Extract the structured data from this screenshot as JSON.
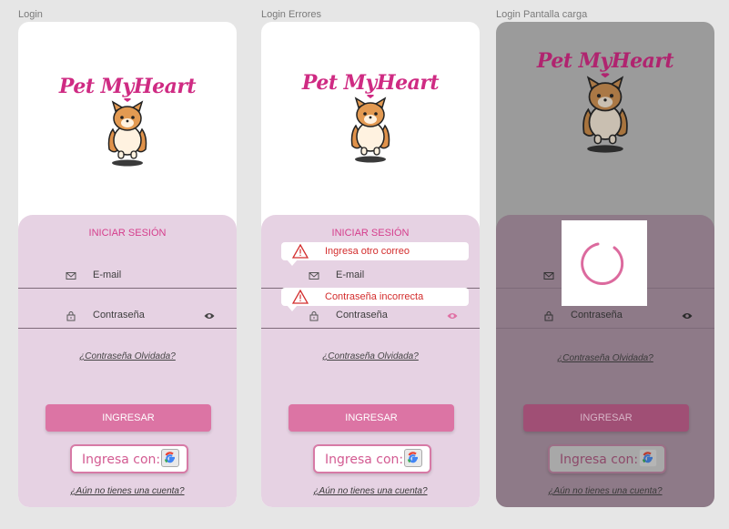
{
  "frames": [
    {
      "label": "Login",
      "logo": "Pet MyHeart",
      "title": "INICIAR SESIÓN",
      "email_placeholder": "E-mail",
      "password_placeholder": "Contraseña",
      "forgot": "¿Contraseña Olvidada?",
      "login_button": "INGRESAR",
      "google_button": "Ingresa con:",
      "signup": "¿Aún no tienes una cuenta?"
    },
    {
      "label": "Login Errores",
      "logo": "Pet MyHeart",
      "title": "INICIAR SESIÓN",
      "email_error": "Ingresa otro correo",
      "email_placeholder": "E-mail",
      "password_error": "Contraseña incorrecta",
      "password_placeholder": "Contraseña",
      "forgot": "¿Contraseña Olvidada?",
      "login_button": "INGRESAR",
      "google_button": "Ingresa con:",
      "signup": "¿Aún no tienes una cuenta?"
    },
    {
      "label": "Login Pantalla carga",
      "logo": "Pet MyHeart",
      "password_placeholder": "Contraseña",
      "forgot": "¿Contraseña Olvidada?",
      "login_button": "INGRESAR",
      "google_button": "Ingresa con:",
      "signup": "¿Aún no tienes una cuenta?"
    }
  ],
  "icons": {
    "email": "mail-icon",
    "password": "lock-icon",
    "visibility": "eye-icon",
    "google": "google-icon",
    "warning": "warning-icon",
    "spinner": "loading-spinner-icon"
  },
  "colors": {
    "brand_pink": "#cf2b83",
    "panel": "#e6d2e3",
    "button": "#dc74a4",
    "error": "#d32d2d"
  }
}
